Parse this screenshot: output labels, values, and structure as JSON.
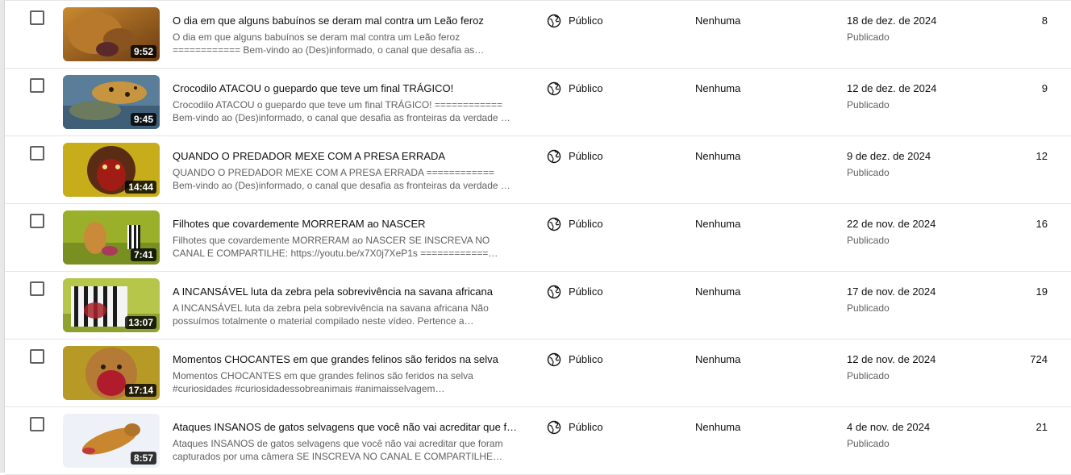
{
  "videos": [
    {
      "title": "O dia em que alguns babuínos se deram mal contra um Leão feroz",
      "description": "O dia em que alguns babuínos se deram mal contra um Leão feroz ============ Bem-vindo ao (Des)informado, o canal que desafia as…",
      "duration": "9:52",
      "visibility": "Público",
      "restrictions": "Nenhuma",
      "date": "18 de dez. de 2024",
      "status": "Publicado",
      "views": "8"
    },
    {
      "title": "Crocodilo ATACOU o guepardo que teve um final TRÁGICO!",
      "description": "Crocodilo ATACOU o guepardo que teve um final TRÁGICO! ============ Bem-vindo ao (Des)informado, o canal que desafia as fronteiras da verdade …",
      "duration": "9:45",
      "visibility": "Público",
      "restrictions": "Nenhuma",
      "date": "12 de dez. de 2024",
      "status": "Publicado",
      "views": "9"
    },
    {
      "title": "QUANDO O PREDADOR MEXE COM A PRESA ERRADA",
      "description": "QUANDO O PREDADOR MEXE COM A PRESA ERRADA ============ Bem-vindo ao (Des)informado, o canal que desafia as fronteiras da verdade e da…",
      "duration": "14:44",
      "visibility": "Público",
      "restrictions": "Nenhuma",
      "date": "9 de dez. de 2024",
      "status": "Publicado",
      "views": "12"
    },
    {
      "title": "Filhotes que covardemente MORRERAM ao NASCER",
      "description": "Filhotes que covardemente MORRERAM ao NASCER SE INSCREVA NO CANAL E COMPARTILHE: https://youtu.be/x7X0j7XeP1s ============…",
      "duration": "7:41",
      "visibility": "Público",
      "restrictions": "Nenhuma",
      "date": "22 de nov. de 2024",
      "status": "Publicado",
      "views": "16"
    },
    {
      "title": "A INCANSÁVEL luta da zebra pela sobrevivência na savana africana",
      "description": "A INCANSÁVEL luta da zebra pela sobrevivência na savana africana Não possuímos totalmente o material compilado neste vídeo. Pertence a…",
      "duration": "13:07",
      "visibility": "Público",
      "restrictions": "Nenhuma",
      "date": "17 de nov. de 2024",
      "status": "Publicado",
      "views": "19"
    },
    {
      "title": "Momentos CHOCANTES em que grandes felinos são feridos na selva",
      "description": "Momentos CHOCANTES em que grandes felinos são feridos na selva #curiosidades #curiosidadessobreanimais #animaisselvagem…",
      "duration": "17:14",
      "visibility": "Público",
      "restrictions": "Nenhuma",
      "date": "12 de nov. de 2024",
      "status": "Publicado",
      "views": "724"
    },
    {
      "title": "Ataques INSANOS de gatos selvagens que você não vai acreditar que fo…",
      "description": "Ataques INSANOS de gatos selvagens que você não vai acreditar que foram capturados por uma câmera SE INSCREVA NO CANAL E COMPARTILHE…",
      "duration": "8:57",
      "visibility": "Público",
      "restrictions": "Nenhuma",
      "date": "4 de nov. de 2024",
      "status": "Publicado",
      "views": "21"
    }
  ]
}
